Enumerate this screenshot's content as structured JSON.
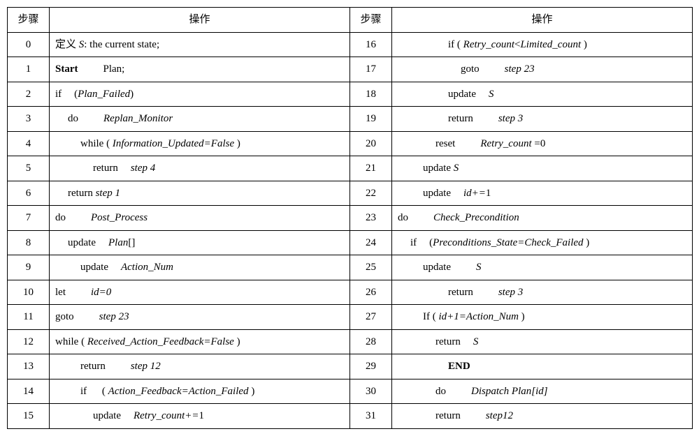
{
  "headers": {
    "left_step": "步骤",
    "left_op": "操作",
    "right_step": "步骤",
    "right_op": "操作"
  },
  "rows": {
    "r0": {
      "ls": "0",
      "lop": "定义 <span class='italic'>S</span>: the current state;",
      "rs": "16",
      "rop": "<span class='indent-4'></span>if ( <span class='italic'>Retry_count</span>&lt;<span class='italic'>Limited_count</span> )"
    },
    "r1": {
      "ls": "1",
      "lop": "<span class='bold'>Start</span><span class='gap'></span><span class='gap'></span>Plan;",
      "rs": "17",
      "rop": "<span class='indent-5'></span>goto<span class='gap'></span><span class='gap'></span><span class='italic'>step 23</span>"
    },
    "r2": {
      "ls": "2",
      "lop": "if<span class='gap'></span>(<span class='italic'>Plan_Failed</span>)",
      "rs": "18",
      "rop": "<span class='indent-4'></span>update<span class='gap'></span><span class='italic'>S</span>"
    },
    "r3": {
      "ls": "3",
      "lop": "<span class='indent-1'></span>do<span class='gap'></span><span class='gap'></span><span class='italic'>Replan_Monitor</span>",
      "rs": "19",
      "rop": "<span class='indent-4'></span>return<span class='gap'></span><span class='gap'></span><span class='italic'>step 3</span>"
    },
    "r4": {
      "ls": "4",
      "lop": "<span class='indent-2'></span>while ( <span class='italic'>Information_Updated=False</span> )",
      "rs": "20",
      "rop": "<span class='indent-3'></span>reset<span class='gap'></span><span class='gap'></span><span class='italic'>Retry_count</span> =0"
    },
    "r5": {
      "ls": "5",
      "lop": "<span class='indent-3'></span>return<span class='gap'></span><span class='italic'>step 4</span>",
      "rs": "21",
      "rop": "<span class='indent-2'></span>update <span class='italic'>S</span>"
    },
    "r6": {
      "ls": "6",
      "lop": "<span class='indent-1'></span>return <span class='italic'>step 1</span>",
      "rs": "22",
      "rop": "<span class='indent-2'></span>update<span class='gap'></span><span class='italic'>id+=</span>1"
    },
    "r7": {
      "ls": "7",
      "lop": "do<span class='gap'></span><span class='gap'></span><span class='italic'>Post_Process</span>",
      "rs": "23",
      "rop": "do<span class='gap'></span><span class='gap'></span><span class='italic'>Check_Precondition</span>"
    },
    "r8": {
      "ls": "8",
      "lop": "<span class='indent-1'></span>update<span class='gap'></span><span class='italic'>Plan</span>[]",
      "rs": "24",
      "rop": "<span class='indent-1'></span>if<span class='gap'></span>(<span class='italic'>Preconditions_State=Check_Failed</span> )"
    },
    "r9": {
      "ls": "9",
      "lop": "<span class='indent-2'></span>update<span class='gap'></span><span class='italic'>Action_Num</span>",
      "rs": "25",
      "rop": "<span class='indent-2'></span>update<span class='gap'></span><span class='gap'></span><span class='italic'>S</span>"
    },
    "r10": {
      "ls": "10",
      "lop": "let<span class='gap'></span><span class='gap'></span><span class='italic'>id=0</span>",
      "rs": "26",
      "rop": "<span class='indent-4'></span>return<span class='gap'></span><span class='gap'></span><span class='italic'>step 3</span>"
    },
    "r11": {
      "ls": "11",
      "lop": "goto<span class='gap'></span><span class='gap'></span><span class='italic'>step 23</span>",
      "rs": "27",
      "rop": "<span class='indent-2'></span>If ( <span class='italic'>id+1=Action_Num</span> )"
    },
    "r12": {
      "ls": "12",
      "lop": "while ( <span class='italic'>Received_Action_Feedback=False</span> )",
      "rs": "28",
      "rop": "<span class='indent-3'></span>return<span class='gap'></span><span class='italic'>S</span>"
    },
    "r13": {
      "ls": "13",
      "lop": "<span class='indent-2'></span>return<span class='gap'></span><span class='gap'></span><span class='italic'>step 12</span>",
      "rs": "29",
      "rop": "<span class='indent-4'></span><span class='bold'>END</span>"
    },
    "r14": {
      "ls": "14",
      "lop": "<span class='indent-2'></span>if<span class='gap'></span> ( <span class='italic'>Action_Feedback=Action_Failed</span> )",
      "rs": "30",
      "rop": "<span class='indent-3'></span>do<span class='gap'></span><span class='gap'></span><span class='italic'>Dispatch Plan[id]</span>"
    },
    "r15": {
      "ls": "15",
      "lop": "<span class='indent-3'></span>update<span class='gap'></span><span class='italic'>Retry_count+=</span>1",
      "rs": "31",
      "rop": "<span class='indent-3'></span>return<span class='gap'></span><span class='gap'></span><span class='italic'>step12</span>"
    }
  }
}
